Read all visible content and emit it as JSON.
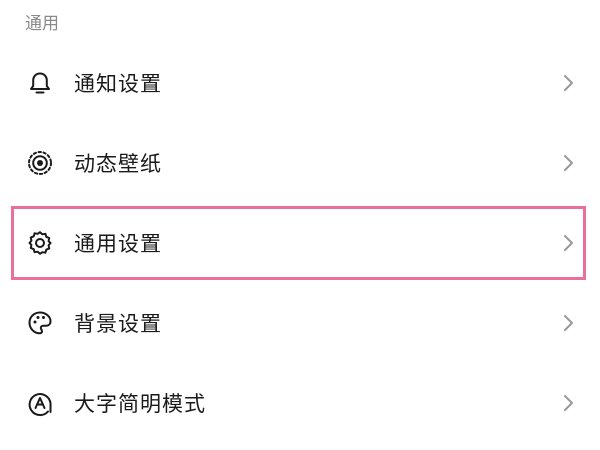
{
  "section": {
    "title": "通用"
  },
  "items": [
    {
      "label": "通知设置",
      "icon": "bell-icon",
      "highlighted": false
    },
    {
      "label": "动态壁纸",
      "icon": "live-wallpaper-icon",
      "highlighted": false
    },
    {
      "label": "通用设置",
      "icon": "gear-icon",
      "highlighted": true
    },
    {
      "label": "背景设置",
      "icon": "palette-icon",
      "highlighted": false
    },
    {
      "label": "大字简明模式",
      "icon": "large-font-icon",
      "highlighted": false
    }
  ],
  "colors": {
    "highlight": "#e8709a",
    "text": "#1a1a1a",
    "header": "#8a8a8a",
    "chevron": "#9a9a9a"
  }
}
